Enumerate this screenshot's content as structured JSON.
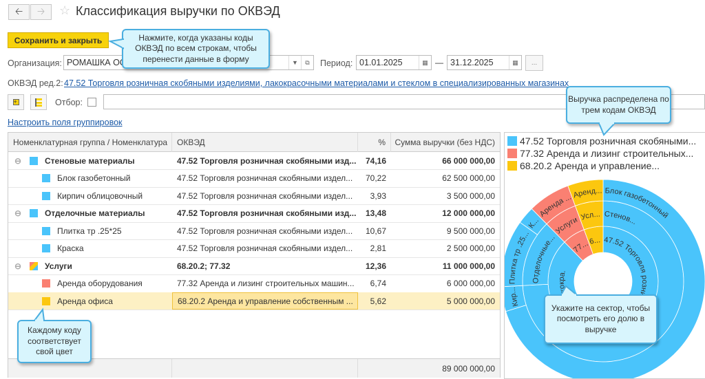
{
  "window": {
    "title": "Классификация выручки по ОКВЭД",
    "back_icon": "arrow-left",
    "forward_icon": "arrow-right",
    "star_icon": "star"
  },
  "toolbar": {
    "save_label": "Сохранить и закрыть"
  },
  "form": {
    "org_label": "Организация:",
    "org_value": "РОМАШКА ОО",
    "period_label": "Период:",
    "date_from": "01.01.2025",
    "date_to": "31.12.2025",
    "dash": "—",
    "more_label": "...",
    "okved_label": "ОКВЭД ред.2:",
    "okved_link": "47.52 Торговля розничная скобяными изделиями, лакокрасочными материалами и стеклом в специализированных магазинах",
    "filter_label": "Отбор:",
    "filter_value": "",
    "grouping_link": "Настроить поля группировок"
  },
  "colors": {
    "c4752": "#4ac4fb",
    "c7732": "#fa8072",
    "c68202": "#fcc70f",
    "accent": "#f7d20c"
  },
  "table": {
    "headers": [
      "Номенклатурная группа / Номенклатура",
      "ОКВЭД",
      "%",
      "Сумма выручки (без НДС)"
    ],
    "rows": [
      {
        "name": "Стеновые материалы",
        "okved": "47.52 Торговля розничная скобяными изд...",
        "pct": "74,16",
        "sum": "66 000 000,00",
        "group": true,
        "color": "#4ac4fb"
      },
      {
        "name": "Блок газобетонный",
        "okved": "47.52 Торговля розничная скобяными издел...",
        "pct": "70,22",
        "sum": "62 500 000,00",
        "color": "#4ac4fb"
      },
      {
        "name": "Кирпич облицовочный",
        "okved": "47.52 Торговля розничная скобяными издел...",
        "pct": "3,93",
        "sum": "3 500 000,00",
        "color": "#4ac4fb"
      },
      {
        "name": "Отделочные материалы",
        "okved": "47.52 Торговля розничная скобяными изд...",
        "pct": "13,48",
        "sum": "12 000 000,00",
        "group": true,
        "color": "#4ac4fb"
      },
      {
        "name": "Плитка тр .25*25",
        "okved": "47.52 Торговля розничная скобяными издел...",
        "pct": "10,67",
        "sum": "9 500 000,00",
        "color": "#4ac4fb"
      },
      {
        "name": "Краска",
        "okved": "47.52 Торговля розничная скобяными издел...",
        "pct": "2,81",
        "sum": "2 500 000,00",
        "color": "#4ac4fb"
      },
      {
        "name": "Услуги",
        "okved": "68.20.2; 77.32",
        "pct": "12,36",
        "sum": "11 000 000,00",
        "group": true,
        "color": "multi"
      },
      {
        "name": "Аренда оборудования",
        "okved": "77.32 Аренда и лизинг строительных машин...",
        "pct": "6,74",
        "sum": "6 000 000,00",
        "color": "#fa8072"
      },
      {
        "name": "Аренда офиса",
        "okved": "68.20.2 Аренда и управление собственным ...",
        "pct": "5,62",
        "sum": "5 000 000,00",
        "color": "#fcc70f",
        "selected": true
      }
    ],
    "total": "89 000 000,00"
  },
  "callouts": {
    "save": "Нажмите, когда указаны коды ОКВЭД по всем строкам, чтобы перенести данные в форму",
    "chart": "Выручка распределена по трем кодам ОКВЭД",
    "sector": "Укажите на сектор, чтобы посмотреть его долю в выручке",
    "color": "Каждому коду соответствует свой цвет"
  },
  "chart_data": {
    "type": "sunburst",
    "legend": [
      {
        "label": "47.52 Торговля розничная скобяными...",
        "color": "#4ac4fb"
      },
      {
        "label": "77.32 Аренда и лизинг строительных...",
        "color": "#fa8072"
      },
      {
        "label": "68.20.2 Аренда и управление...",
        "color": "#fcc70f"
      }
    ],
    "legend_position": "top",
    "rings": [
      [
        {
          "label": "47.52 Торговля розни",
          "value": 87.64,
          "color": "#4ac4fb"
        },
        {
          "label": "77...",
          "value": 6.74,
          "color": "#fa8072"
        },
        {
          "label": "6...",
          "value": 5.62,
          "color": "#fcc70f"
        }
      ],
      [
        {
          "label": "Стенов...",
          "value": 74.16,
          "color": "#4ac4fb"
        },
        {
          "label": "Отделочные...",
          "value": 13.48,
          "color": "#4ac4fb"
        },
        {
          "label": "Услуги",
          "value": 6.74,
          "color": "#fa8072"
        },
        {
          "label": "Усл...",
          "value": 5.62,
          "color": "#fcc70f"
        }
      ],
      [
        {
          "label": "Блок газобетонный",
          "value": 70.22,
          "color": "#4ac4fb"
        },
        {
          "label": "Кир...",
          "value": 3.93,
          "color": "#4ac4fb"
        },
        {
          "label": "Плитка тр .25...",
          "value": 10.67,
          "color": "#4ac4fb"
        },
        {
          "label": "К...",
          "value": 2.81,
          "color": "#4ac4fb"
        },
        {
          "label": "Аренда ...",
          "value": 6.74,
          "color": "#fa8072"
        },
        {
          "label": "Аренд...",
          "value": 5.62,
          "color": "#fcc70f"
        }
      ]
    ],
    "inner_extra_label": "и, лакокра..."
  }
}
